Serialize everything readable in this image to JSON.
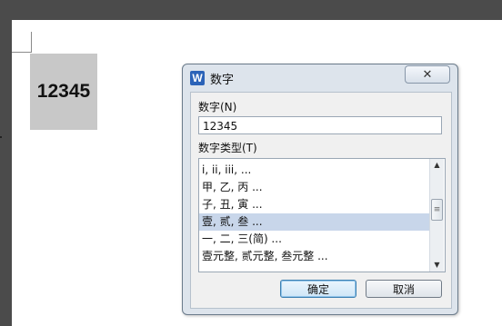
{
  "document": {
    "selected_number": "12345"
  },
  "dialog": {
    "title": "数字",
    "app_icon_letter": "W",
    "close_symbol": "✕",
    "number_label": "数字(N)",
    "number_value": "12345",
    "type_label": "数字类型(T)",
    "types": [
      "i, ii, iii, ...",
      "甲, 乙, 丙 ...",
      "子, 丑, 寅 ...",
      "壹, 贰, 叁 ...",
      "一, 二, 三(简) ...",
      "壹元整, 贰元整, 叁元整 ..."
    ],
    "selected_type_index": 3,
    "ok_label": "确定",
    "cancel_label": "取消",
    "scroll_up_glyph": "▲",
    "scroll_down_glyph": "▼",
    "scroll_grip_glyph": "≡"
  },
  "colors": {
    "accent": "#2b63b8",
    "selection": "#c8d6ea",
    "highlight_box": "#c8c8c8"
  }
}
